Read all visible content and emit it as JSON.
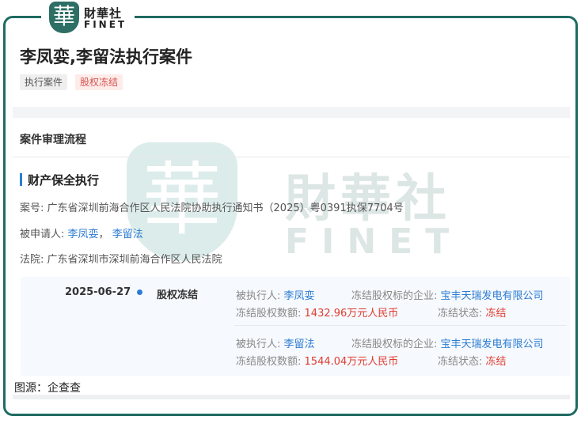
{
  "logo": {
    "glyph": "華",
    "name_cn": "財華社",
    "name_en": "FINET"
  },
  "watermark": {
    "glyph": "華",
    "name_cn": "財華社",
    "name_en": "FINET"
  },
  "title": "李凤娈,李留法执行案件",
  "tags": [
    "执行案件",
    "股权冻结"
  ],
  "section_title": "案件审理流程",
  "subsection_title": "财产保全执行",
  "case_info": {
    "case_no_label": "案号:",
    "case_no": "广东省深圳前海合作区人民法院协助执行通知书（2025）粤0391执保7704号",
    "respondent_label": "被申请人:",
    "respondents": [
      "李凤娈",
      "李留法"
    ],
    "respondent_sep": "，",
    "court_label": "法院:",
    "court": "广东省深圳市深圳前海合作区人民法院"
  },
  "event": {
    "date": "2025-06-27",
    "type": "股权冻结",
    "labels": {
      "executed_person": "被执行人:",
      "target_company": "冻结股权标的企业:",
      "amount": "冻结股权数额:",
      "status": "冻结状态:"
    },
    "records": [
      {
        "executed_person": "李凤娈",
        "target_company": "宝丰天瑞发电有限公司",
        "amount": "1432.96万元人民币",
        "status": "冻结"
      },
      {
        "executed_person": "李留法",
        "target_company": "宝丰天瑞发电有限公司",
        "amount": "1544.04万元人民币",
        "status": "冻结"
      }
    ]
  },
  "source_text": "图源：企查查",
  "colors": {
    "brand": "#1f6b62",
    "link": "#2b7cd3",
    "alert": "#e03c31"
  }
}
